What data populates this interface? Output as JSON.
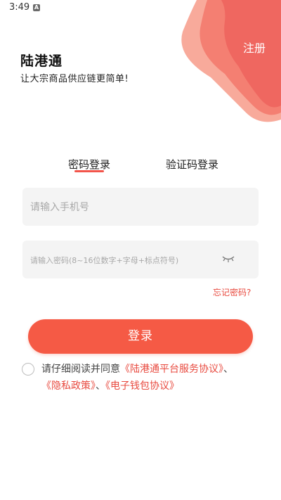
{
  "status_bar": {
    "time": "3:49",
    "notification_badge": "A"
  },
  "header": {
    "register_label": "注册",
    "brand_name": "陆港通",
    "slogan": "让大宗商品供应链更简单!"
  },
  "tabs": [
    {
      "label": "密码登录",
      "active": true
    },
    {
      "label": "验证码登录",
      "active": false
    }
  ],
  "form": {
    "phone_placeholder": "请输入手机号",
    "password_placeholder": "请输入密码(8~16位数字+字母+标点符号)",
    "forgot_label": "忘记密码?",
    "login_label": "登录"
  },
  "agreement": {
    "prefix": "请仔细阅读并同意",
    "platform_link": "《陆港通平台服务协议》",
    "sep1": "、",
    "privacy_link": "《隐私政策》",
    "sep2": "、",
    "wallet_link": "《电子钱包协议》"
  },
  "colors": {
    "accent": "#f55a45",
    "link": "#e84a3f",
    "blob_dark": "#f06a62",
    "blob_light": "#f9b3a6"
  }
}
